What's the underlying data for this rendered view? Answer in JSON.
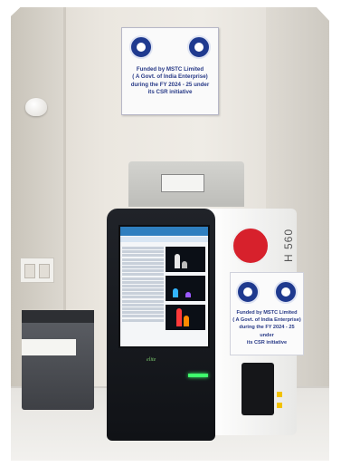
{
  "sign": {
    "lines": [
      "Funded by MSTC Limited",
      "( A Govt. of India Enterprise)",
      "during the FY 2024 - 25 under",
      "its CSR initiative"
    ]
  },
  "device": {
    "model": "H 560",
    "brand": "elite"
  },
  "panel": {
    "lines": [
      "Funded by MSTC Limited",
      "( A Govt. of India Enterprise)",
      "during the FY 2024 - 25 under",
      "its CSR initiative"
    ]
  },
  "colors": {
    "sign_text": "#283a87",
    "logo": "#1f3a8f",
    "led": "#3fff6c",
    "red_tag": "#d7212c"
  }
}
